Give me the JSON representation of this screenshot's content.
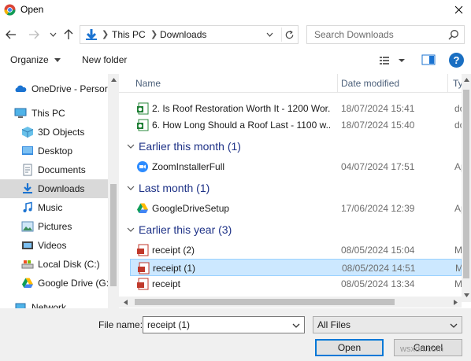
{
  "window": {
    "title": "Open"
  },
  "address": {
    "crumbs": [
      "This PC",
      "Downloads"
    ]
  },
  "search": {
    "placeholder": "Search Downloads"
  },
  "toolbar": {
    "organize": "Organize",
    "new_folder": "New folder",
    "help": "?"
  },
  "nav": {
    "items": [
      {
        "label": "OneDrive - Persor",
        "icon": "onedrive-cloud-icon"
      },
      {
        "label": "This PC",
        "icon": "this-pc-icon"
      },
      {
        "label": "3D Objects",
        "icon": "3d-objects-icon"
      },
      {
        "label": "Desktop",
        "icon": "desktop-folder-icon"
      },
      {
        "label": "Documents",
        "icon": "documents-folder-icon"
      },
      {
        "label": "Downloads",
        "icon": "downloads-folder-icon",
        "selected": true
      },
      {
        "label": "Music",
        "icon": "music-folder-icon"
      },
      {
        "label": "Pictures",
        "icon": "pictures-folder-icon"
      },
      {
        "label": "Videos",
        "icon": "videos-folder-icon"
      },
      {
        "label": "Local Disk (C:)",
        "icon": "local-disk-icon"
      },
      {
        "label": "Google Drive (G:",
        "icon": "google-drive-icon"
      },
      {
        "label": "Network",
        "icon": "network-icon"
      }
    ]
  },
  "columns": {
    "name": "Name",
    "date": "Date modified",
    "type": "Ty"
  },
  "files": {
    "top_rows": [
      {
        "name": "2. Is Roof Restoration Worth It - 1200 Wor...",
        "date": "18/07/2024 15:41",
        "type": "do"
      },
      {
        "name": "6. How Long Should a Roof Last - 1100 w...",
        "date": "18/07/2024 15:40",
        "type": "do"
      }
    ],
    "groups": [
      {
        "label": "Earlier this month (1)",
        "rows": [
          {
            "name": "ZoomInstallerFull",
            "date": "04/07/2024 17:51",
            "type": "Ap"
          }
        ]
      },
      {
        "label": "Last month (1)",
        "rows": [
          {
            "name": "GoogleDriveSetup",
            "date": "17/06/2024 12:39",
            "type": "Ap"
          }
        ]
      },
      {
        "label": "Earlier this year (3)",
        "rows": [
          {
            "name": "receipt (2)",
            "date": "08/05/2024 15:04",
            "type": "M"
          },
          {
            "name": "receipt (1)",
            "date": "08/05/2024 14:51",
            "type": "M",
            "selected": true
          },
          {
            "name": "receipt",
            "date": "08/05/2024 13:34",
            "type": "M"
          }
        ]
      }
    ]
  },
  "bottom": {
    "filename_label": "File name:",
    "filename_value": "receipt (1)",
    "filetype_value": "All Files",
    "open": "Open",
    "cancel": "Cancel"
  },
  "watermark": "wsxdn.com",
  "colors": {
    "accent": "#0078d7",
    "selection": "#cce8ff",
    "group_label": "#1e3287"
  }
}
